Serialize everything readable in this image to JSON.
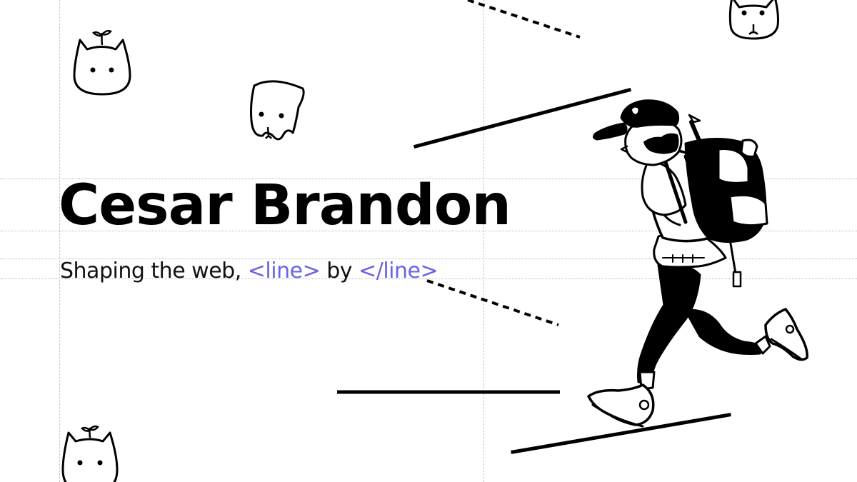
{
  "hero": {
    "name": "Cesar Brandon",
    "tagline": {
      "prefix": "Shaping the web, ",
      "open_tag": "<line>",
      "middle": " by ",
      "close_tag": "</line>"
    }
  },
  "colors": {
    "ink": "#000000",
    "tag_accent": "#6b63e6",
    "guide": "#b8b8b8",
    "background": "#ffffff"
  },
  "icons": {
    "mascot": "sprout-bunny-mascot",
    "figure": "running-backpacker-illustration"
  }
}
